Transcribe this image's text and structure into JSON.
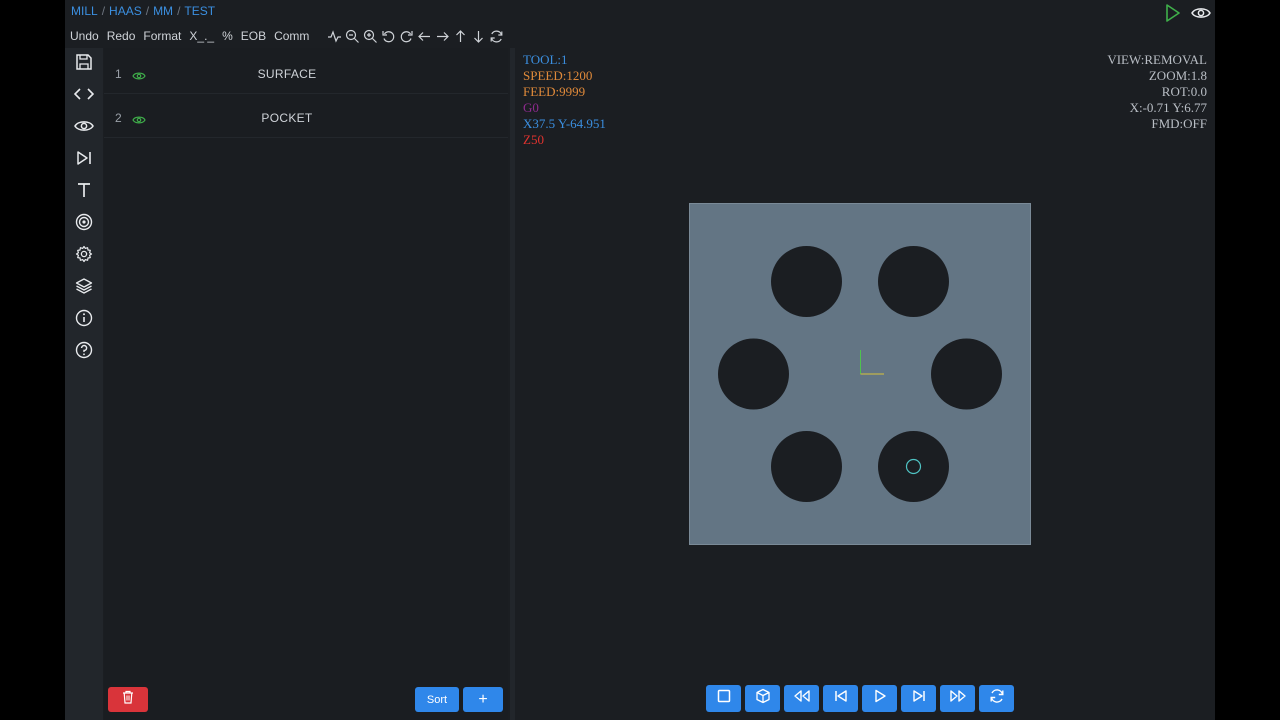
{
  "breadcrumb": [
    "MILL",
    "HAAS",
    "MM",
    "TEST"
  ],
  "header": {
    "run_icon": "play-icon",
    "preview_icon": "eye-icon"
  },
  "toolbar": {
    "undo": "Undo",
    "redo": "Redo",
    "format": "Format",
    "x_toggle": "X_._",
    "percent": "%",
    "eob": "EOB",
    "comm": "Comm",
    "icons": [
      "pulse-icon",
      "zoom-out-icon",
      "zoom-in-icon",
      "rotate-left-icon",
      "rotate-right-icon",
      "arrow-left-icon",
      "arrow-right-icon",
      "arrow-up-icon",
      "arrow-down-icon",
      "refresh-icon"
    ]
  },
  "sidebar": {
    "items": [
      {
        "icon": "save-icon"
      },
      {
        "icon": "code-icon"
      },
      {
        "icon": "eye-icon"
      },
      {
        "icon": "skip-forward-icon"
      },
      {
        "icon": "text-icon"
      },
      {
        "icon": "target-icon"
      },
      {
        "icon": "gear-icon"
      },
      {
        "icon": "layers-icon"
      },
      {
        "icon": "info-icon"
      },
      {
        "icon": "help-icon"
      }
    ]
  },
  "operations": [
    {
      "number": "1",
      "name": "SURFACE",
      "visible": true
    },
    {
      "number": "2",
      "name": "POCKET",
      "visible": true
    }
  ],
  "bottom_bar": {
    "sort_label": "Sort",
    "add_label": "+"
  },
  "readout": {
    "tool": "TOOL:1",
    "speed": "SPEED:1200",
    "feed": "FEED:9999",
    "gcode": "G0",
    "xy": "X37.5 Y-64.951",
    "z": "Z50",
    "view": "VIEW:REMOVAL",
    "zoom": "ZOOM:1.8",
    "rot": "ROT:0.0",
    "cursor": "X:-0.71 Y:6.77",
    "fmd": "FMD:OFF"
  },
  "colors": {
    "tool": "#3b8fe0",
    "speed": "#e08a3a",
    "feed": "#e08a3a",
    "gcode": "#8e2a8e",
    "xy": "#3b8fe0",
    "z": "#e0332f",
    "stock": "#637584",
    "hole": "#1b1e22",
    "accent": "#2f87ea",
    "danger": "#d9343a"
  },
  "player_controls": [
    "stop-icon",
    "cube-icon",
    "fast-rewind-icon",
    "step-back-icon",
    "play-icon",
    "step-forward-icon",
    "fast-forward-icon",
    "loop-icon"
  ]
}
